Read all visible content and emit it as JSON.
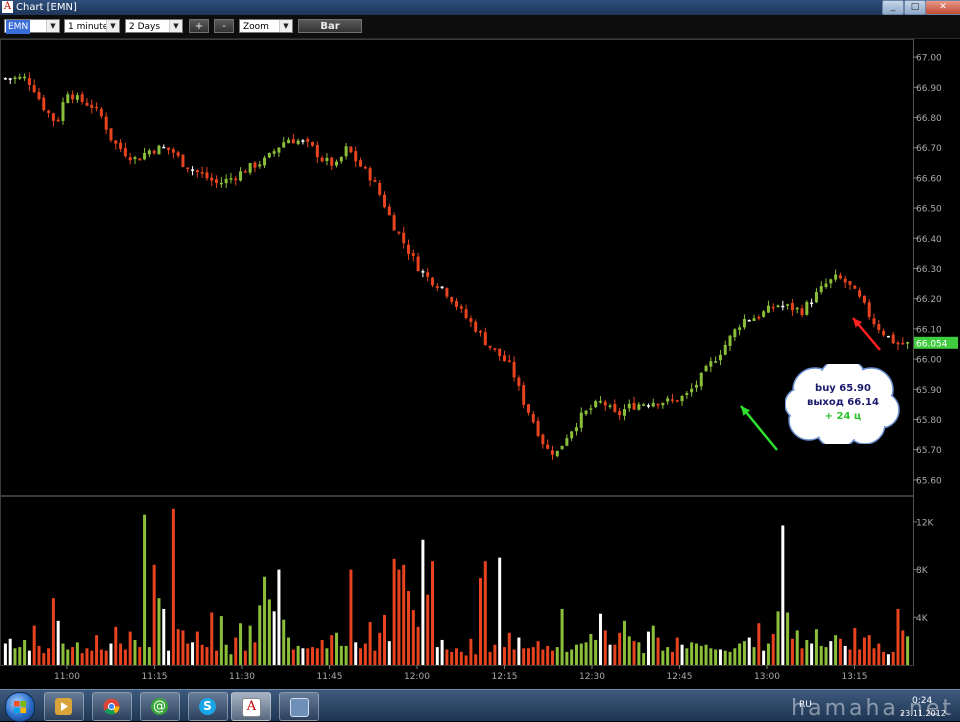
{
  "window": {
    "title": "Chart [EMN]",
    "app_icon_glyph": "A",
    "minimize_glyph": "_",
    "maximize_glyph": "□",
    "close_glyph": "✕"
  },
  "toolbar": {
    "symbol": "EMN",
    "interval": "1 minute",
    "range": "2 Days",
    "plus_label": "+",
    "minus_label": "-",
    "zoom_label": "Zoom",
    "bar_label": "Bar"
  },
  "callout": {
    "line1": "buy 65.90",
    "line2": "выход 66.14",
    "line3": "+ 24 ц"
  },
  "taskbar": {
    "lang": "RU",
    "time": "0:24",
    "date": "23.11.2012",
    "watermark": "hamaha.net",
    "apps": [
      "media-player-icon",
      "chrome-icon",
      "mail-agent-icon",
      "skype-icon",
      "trading-app-icon",
      "window-manager-icon"
    ]
  },
  "colors": {
    "up": "#8bbf3a",
    "down": "#e8431f",
    "neutral": "#ffffff",
    "last_price_bg": "#3fcc3f",
    "buy_arrow": "#2ee02e",
    "exit_arrow": "#ff2020"
  },
  "chart_data": {
    "type": "candlestick",
    "title": "",
    "symbol": "EMN",
    "interval": "1 minute",
    "price_axis": {
      "ticks": [
        "67.00",
        "66.90",
        "66.80",
        "66.70",
        "66.60",
        "66.50",
        "66.40",
        "66.30",
        "66.20",
        "66.10",
        "66.00",
        "65.90",
        "65.80",
        "65.70",
        "65.60"
      ],
      "range": [
        65.55,
        67.06
      ],
      "last_price": "66.054"
    },
    "volume_axis": {
      "ticks": [
        "12K",
        "8K",
        "4K"
      ],
      "range": [
        0,
        14000
      ]
    },
    "time_axis": {
      "ticks": [
        "11:00",
        "11:15",
        "11:30",
        "11:45",
        "12:00",
        "12:15",
        "12:30",
        "12:45",
        "13:00",
        "13:15"
      ]
    },
    "price_path": [
      [
        10.88,
        66.93
      ],
      [
        10.9,
        66.91
      ],
      [
        10.93,
        66.84
      ],
      [
        10.97,
        66.78
      ],
      [
        11.0,
        66.89
      ],
      [
        11.03,
        66.86
      ],
      [
        11.07,
        66.84
      ],
      [
        11.1,
        66.8
      ],
      [
        11.13,
        66.72
      ],
      [
        11.17,
        66.68
      ],
      [
        11.2,
        66.66
      ],
      [
        11.23,
        66.69
      ],
      [
        11.27,
        66.7
      ],
      [
        11.3,
        66.69
      ],
      [
        11.33,
        66.65
      ],
      [
        11.37,
        66.62
      ],
      [
        11.4,
        66.6
      ],
      [
        11.43,
        66.58
      ],
      [
        11.47,
        66.6
      ],
      [
        11.5,
        66.62
      ],
      [
        11.53,
        66.64
      ],
      [
        11.57,
        66.66
      ],
      [
        11.6,
        66.7
      ],
      [
        11.63,
        66.73
      ],
      [
        11.67,
        66.72
      ],
      [
        11.7,
        66.7
      ],
      [
        11.73,
        66.66
      ],
      [
        11.77,
        66.64
      ],
      [
        11.8,
        66.7
      ],
      [
        11.83,
        66.65
      ],
      [
        11.87,
        66.6
      ],
      [
        11.9,
        66.53
      ],
      [
        11.93,
        66.45
      ],
      [
        11.97,
        66.37
      ],
      [
        12.0,
        66.31
      ],
      [
        12.03,
        66.27
      ],
      [
        12.07,
        66.24
      ],
      [
        12.1,
        66.2
      ],
      [
        12.13,
        66.15
      ],
      [
        12.17,
        66.1
      ],
      [
        12.2,
        66.05
      ],
      [
        12.23,
        66.02
      ],
      [
        12.27,
        65.97
      ],
      [
        12.3,
        65.87
      ],
      [
        12.33,
        65.8
      ],
      [
        12.37,
        65.7
      ],
      [
        12.4,
        65.69
      ],
      [
        12.43,
        65.75
      ],
      [
        12.47,
        65.81
      ],
      [
        12.5,
        65.84
      ],
      [
        12.53,
        65.86
      ],
      [
        12.57,
        65.81
      ],
      [
        12.6,
        65.84
      ],
      [
        12.63,
        65.85
      ],
      [
        12.67,
        65.86
      ],
      [
        12.7,
        65.86
      ],
      [
        12.73,
        65.86
      ],
      [
        12.77,
        65.88
      ],
      [
        12.8,
        65.92
      ],
      [
        12.83,
        65.97
      ],
      [
        12.87,
        66.03
      ],
      [
        12.9,
        66.08
      ],
      [
        12.93,
        66.13
      ],
      [
        12.97,
        66.14
      ],
      [
        13.0,
        66.16
      ],
      [
        13.03,
        66.18
      ],
      [
        13.07,
        66.17
      ],
      [
        13.1,
        66.16
      ],
      [
        13.13,
        66.2
      ],
      [
        13.17,
        66.25
      ],
      [
        13.2,
        66.27
      ],
      [
        13.23,
        66.25
      ],
      [
        13.27,
        66.19
      ],
      [
        13.3,
        66.13
      ],
      [
        13.33,
        66.09
      ],
      [
        13.37,
        66.05
      ]
    ],
    "volume_levels": [
      1800,
      2200,
      1400,
      1500,
      2100,
      1200,
      3300,
      1600,
      1000,
      1400,
      5600,
      3700,
      1800,
      1300,
      1500,
      1900,
      1000,
      1400,
      1200,
      2500,
      1300,
      1200,
      1800,
      3200,
      1800,
      1300,
      2800,
      2100,
      1500,
      12600,
      1500,
      8400,
      5600,
      4700,
      1200,
      13100,
      3000,
      2900,
      1800,
      1900,
      2800,
      1700,
      1500,
      4400,
      1200,
      4100,
      1700,
      900,
      2300,
      3500,
      1200,
      3300,
      1900,
      5000,
      7400,
      5500,
      4500,
      8000,
      3800,
      2300,
      1300,
      1600,
      1400,
      1400,
      1500,
      1400,
      2100,
      1400,
      2500,
      2700,
      1600,
      1600,
      8000,
      1900,
      1400,
      1800,
      3600,
      1200,
      2700,
      4200,
      2000,
      8900,
      8000,
      8400,
      6200,
      4600,
      3200,
      10500,
      5900,
      8700,
      1500,
      2100,
      1300,
      1100,
      1400,
      1100,
      800,
      2200,
      900,
      7300,
      8700,
      1100,
      1700,
      9000,
      1500,
      2700,
      1300,
      2300,
      1400,
      1400,
      1500,
      2000,
      1300,
      1600,
      1200,
      1500,
      4700,
      1100,
      1300,
      1700,
      1800,
      1900,
      2600,
      2100,
      4300,
      2900,
      1700,
      1700,
      2700,
      3700,
      2400,
      2000,
      1900,
      1000,
      2800,
      3300,
      2300,
      1200,
      1500,
      1100,
      2300,
      1700,
      1400,
      1900,
      1800,
      1600,
      1700,
      1400,
      1300,
      1300,
      1200,
      1100,
      1400,
      1800,
      2000,
      2300,
      1500,
      3500,
      1200,
      1800,
      2600,
      4500,
      11700,
      4400,
      2200,
      2900,
      1400,
      2100,
      1800,
      3000,
      1600,
      1500,
      2000,
      2500,
      2200,
      1600,
      1300,
      3100,
      1300,
      2300,
      2500,
      1400,
      1800,
      1100,
      900,
      1100,
      4700,
      2900,
      2400
    ]
  }
}
